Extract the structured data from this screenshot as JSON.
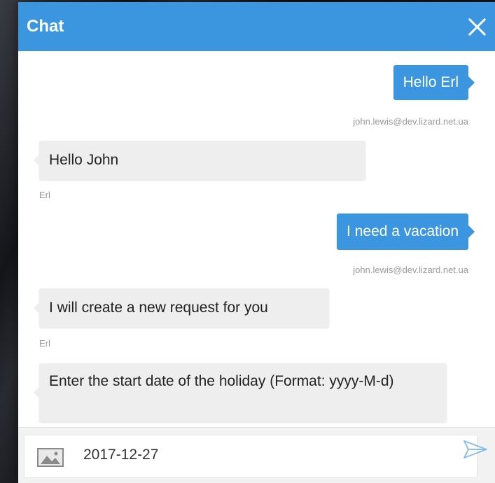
{
  "header": {
    "title": "Chat"
  },
  "messages": [
    {
      "direction": "out",
      "text": "Hello Erl",
      "sender": "john.lewis@dev.lizard.net.ua"
    },
    {
      "direction": "in",
      "text": "Hello John",
      "sender": "Erl"
    },
    {
      "direction": "out",
      "text": "I need a vacation",
      "sender": "john.lewis@dev.lizard.net.ua"
    },
    {
      "direction": "in",
      "text": "I will create a new request for you",
      "sender": "Erl"
    },
    {
      "direction": "in",
      "text": "Enter the start date of the holiday (Format: yyyy-M-d)",
      "sender": ""
    }
  ],
  "composer": {
    "value": "2017-12-27",
    "attach_icon": "image-icon",
    "send_icon": "send-icon"
  },
  "colors": {
    "accent": "#3b95df",
    "incoming_bubble": "#eeeeee",
    "sender_text": "#9a9a9a"
  }
}
